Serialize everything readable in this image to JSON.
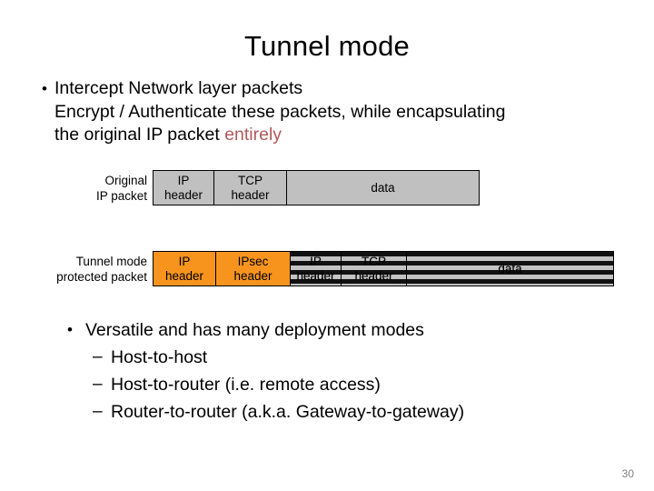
{
  "slide": {
    "title": "Tunnel mode",
    "page_number": "30",
    "accent_color": "#b05a5a",
    "orange_color": "#f7941e",
    "gray_color": "#c0c0c0"
  },
  "top_bullets": {
    "marker": "•",
    "line1": "Intercept Network layer packets",
    "line2": "Encrypt / Authenticate these packets, while encapsulating",
    "line3_prefix": "the original IP packet ",
    "line3_accent": "entirely"
  },
  "diagram_original": {
    "label_line1": "Original",
    "label_line2": "IP packet",
    "segments": [
      {
        "line1": "IP",
        "line2": "header",
        "fill": "gray"
      },
      {
        "line1": "TCP",
        "line2": "header",
        "fill": "gray"
      },
      {
        "line1": "data",
        "line2": "",
        "fill": "gray"
      }
    ]
  },
  "diagram_tunnel": {
    "label_line1": "Tunnel mode",
    "label_line2": "protected packet",
    "segments": [
      {
        "line1": "IP",
        "line2": "header",
        "fill": "orange"
      },
      {
        "line1": "IPsec",
        "line2": "header",
        "fill": "orange"
      },
      {
        "line1": "IP",
        "line2": "header",
        "fill": "hatch"
      },
      {
        "line1": "TCP",
        "line2": "header",
        "fill": "hatch"
      },
      {
        "line1": "data",
        "line2": "",
        "fill": "hatch"
      }
    ]
  },
  "bottom_bullets": {
    "bullet_marker": "•",
    "dash_marker": "–",
    "items": [
      {
        "level": 1,
        "label": "Versatile and has many deployment modes"
      },
      {
        "level": 2,
        "label": "Host-to-host"
      },
      {
        "level": 2,
        "label": "Host-to-router (i.e. remote access)"
      },
      {
        "level": 2,
        "label": "Router-to-router (a.k.a. Gateway-to-gateway)"
      }
    ]
  }
}
